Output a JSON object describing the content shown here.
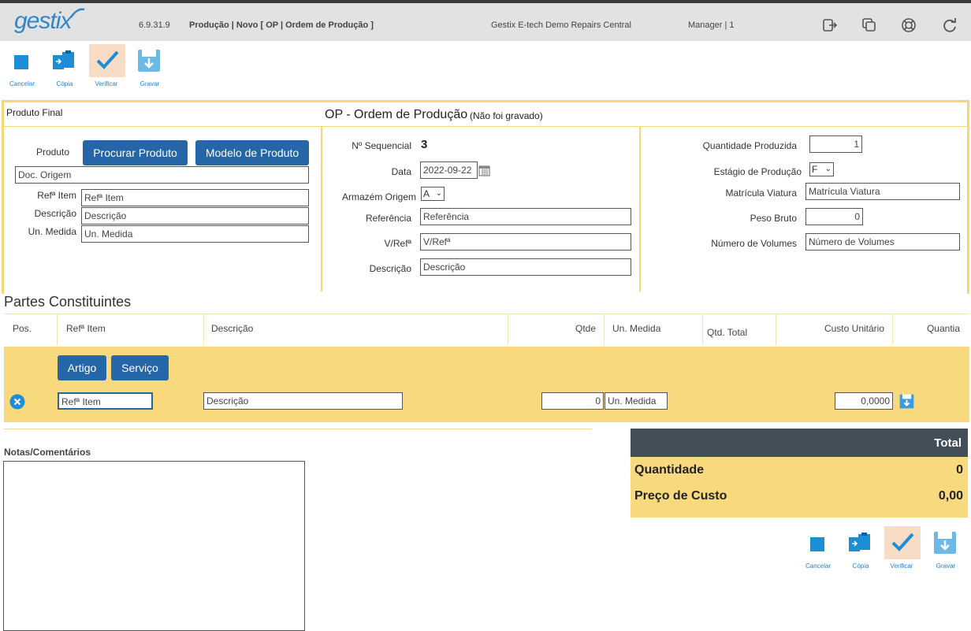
{
  "header": {
    "logo": "gestix",
    "version": "6.9.31.9",
    "breadcrumb": "Produção | Novo [ OP | Ordem de Produção ]",
    "company": "Gestix E-tech Demo Repairs Central",
    "user": "Manager | 1"
  },
  "toolbar": {
    "cancel_label": "Cancelar",
    "copy_label": "Cópia",
    "verify_label": "Verificar",
    "save_label": "Gravar"
  },
  "form": {
    "section_label": "Produto Final",
    "title": "OP - Ordem de Produção",
    "title_note": "(Não foi gravado)",
    "product": {
      "label": "Produto",
      "search_button": "Procurar Produto",
      "model_button": "Modelo de Produto",
      "doc_origem_placeholder": "Doc. Origem",
      "ref_label": "Refª Item",
      "ref_placeholder": "Refª Item",
      "desc_label": "Descrição",
      "desc_placeholder": "Descrição",
      "unit_label": "Un. Medida",
      "unit_placeholder": "Un. Medida"
    },
    "middle": {
      "seq_label": "Nº Sequencial",
      "seq_value": "3",
      "date_label": "Data",
      "date_value": "2022-09-22",
      "warehouse_label": "Armazém Origem",
      "warehouse_value": "A",
      "reference_label": "Referência",
      "reference_placeholder": "Referência",
      "vref_label": "V/Refª",
      "vref_placeholder": "V/Refª",
      "description_label": "Descrição",
      "description_placeholder": "Descrição"
    },
    "right": {
      "qty_label": "Quantidade Produzida",
      "qty_value": "1",
      "stage_label": "Estágio de Produção",
      "stage_value": "F",
      "plate_label": "Matrícula Viatura",
      "plate_placeholder": "Matrícula Viatura",
      "weight_label": "Peso Bruto",
      "weight_value": "0",
      "volumes_label": "Número de Volumes",
      "volumes_placeholder": "Número de Volumes"
    }
  },
  "parts": {
    "title": "Partes Constituintes",
    "columns": [
      "Pos.",
      "Refª Item",
      "Descrição",
      "Qtde",
      "Un. Medida",
      "Qtd. Total",
      "Custo Unitário",
      "Quantia"
    ],
    "add_article_button": "Artigo",
    "add_service_button": "Serviço",
    "row": {
      "ref_placeholder": "Refª Item",
      "desc_placeholder": "Descrição",
      "qty_value": "0",
      "unit_placeholder": "Un. Medida",
      "unit_cost_value": "0,0000"
    }
  },
  "notes": {
    "label": "Notas/Comentários"
  },
  "totals": {
    "header": "Total",
    "quantity_label": "Quantidade",
    "quantity_value": "0",
    "cost_label": "Preço de Custo",
    "cost_value": "0,00"
  },
  "colors": {
    "accent_blue": "#2566a8",
    "panel_yellow": "#f8d97e",
    "border_yellow": "#f5d77a",
    "totals_dark": "#424f58"
  }
}
